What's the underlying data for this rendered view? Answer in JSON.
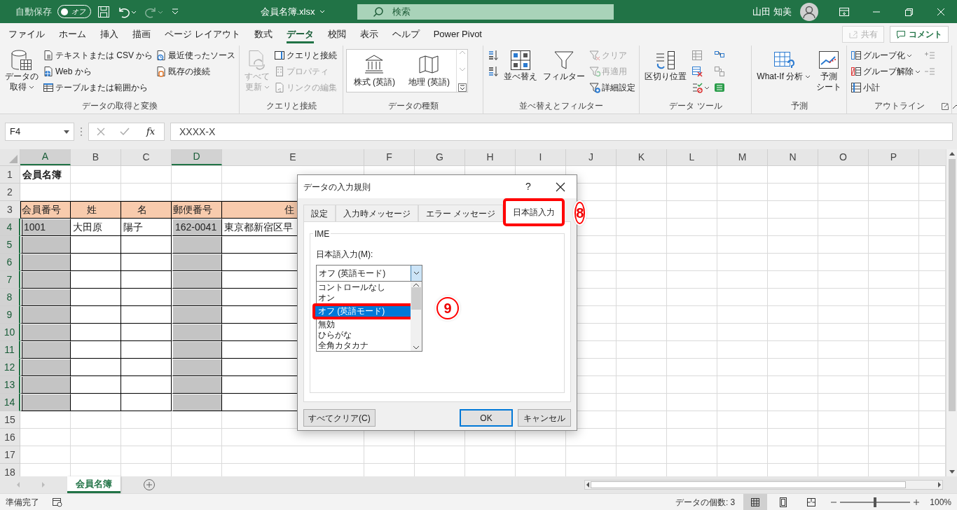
{
  "title_bar": {
    "autosave_label": "自動保存",
    "autosave_on": false,
    "autosave_state": "オフ",
    "quick_access": [
      {
        "kind": "save",
        "disabled": false
      },
      {
        "kind": "undo",
        "disabled": false
      },
      {
        "kind": "redo",
        "disabled": true
      },
      {
        "kind": "customize",
        "disabled": false
      }
    ],
    "filename": "会員名簿.xlsx",
    "search_placeholder": "検索",
    "user_name": "山田 知美"
  },
  "menu_tabs": [
    {
      "label": "ファイル",
      "selected": false
    },
    {
      "label": "ホーム",
      "selected": false
    },
    {
      "label": "挿入",
      "selected": false
    },
    {
      "label": "描画",
      "selected": false
    },
    {
      "label": "ページ レイアウト",
      "selected": false
    },
    {
      "label": "数式",
      "selected": false
    },
    {
      "label": "データ",
      "selected": true
    },
    {
      "label": "校閲",
      "selected": false
    },
    {
      "label": "表示",
      "selected": false
    },
    {
      "label": "ヘルプ",
      "selected": false
    },
    {
      "label": "Power Pivot",
      "selected": false
    }
  ],
  "share_button": {
    "label": "共有",
    "disabled": true
  },
  "comment_button": {
    "label": "コメント"
  },
  "ribbon_groups": [
    {
      "label": "データの取得と変換",
      "launcher": false,
      "items": [
        {
          "kind": "large",
          "label_lines": [
            "データの",
            "取得"
          ],
          "dropdown": true,
          "disabled": false
        },
        {
          "kind": "small",
          "label": "テキストまたは CSV から",
          "disabled": false
        },
        {
          "kind": "small",
          "label": "Web から",
          "disabled": false
        },
        {
          "kind": "small",
          "label": "テーブルまたは範囲から",
          "disabled": false
        },
        {
          "kind": "small",
          "label": "最近使ったソース",
          "disabled": false
        },
        {
          "kind": "small",
          "label": "既存の接続",
          "disabled": false
        }
      ]
    },
    {
      "label": "クエリと接続",
      "launcher": false,
      "items": [
        {
          "kind": "large",
          "label_lines": [
            "すべて",
            "更新"
          ],
          "dropdown": true,
          "disabled": true
        },
        {
          "kind": "small",
          "label": "クエリと接続",
          "disabled": false
        },
        {
          "kind": "small",
          "label": "プロパティ",
          "disabled": true
        },
        {
          "kind": "small",
          "label": "リンクの編集",
          "disabled": true
        }
      ]
    },
    {
      "label": "データの種類",
      "launcher": false,
      "items": [
        {
          "kind": "gallery",
          "options": [
            "株式 (英語)",
            "地理 (英語)"
          ]
        }
      ]
    },
    {
      "label": "並べ替えとフィルター",
      "launcher": false,
      "items": [
        {
          "kind": "icon",
          "disabled": false
        },
        {
          "kind": "icon",
          "disabled": false
        },
        {
          "kind": "large",
          "label_lines": [
            "並べ替え"
          ],
          "disabled": false
        },
        {
          "kind": "large",
          "label_lines": [
            "フィルター"
          ],
          "disabled": false
        },
        {
          "kind": "small",
          "label": "クリア",
          "disabled": true
        },
        {
          "kind": "small",
          "label": "再適用",
          "disabled": true
        },
        {
          "kind": "small",
          "label": "詳細設定",
          "disabled": false
        }
      ]
    },
    {
      "label": "データ ツール",
      "launcher": false,
      "items": [
        {
          "kind": "large",
          "label_lines": [
            "区切り位置"
          ],
          "disabled": false
        },
        {
          "kind": "icon",
          "disabled": true
        },
        {
          "kind": "icon",
          "disabled": false
        },
        {
          "kind": "icon",
          "disabled": false,
          "dropdown": true
        },
        {
          "kind": "icon",
          "disabled": false
        },
        {
          "kind": "icon",
          "disabled": true
        },
        {
          "kind": "icon",
          "disabled": false
        }
      ]
    },
    {
      "label": "予測",
      "launcher": false,
      "items": [
        {
          "kind": "large",
          "label_lines": [
            "What-If 分析"
          ],
          "dropdown": true,
          "disabled": false
        },
        {
          "kind": "large",
          "label_lines": [
            "予測",
            "シート"
          ],
          "disabled": false
        }
      ]
    },
    {
      "label": "アウトライン",
      "launcher": true,
      "items": [
        {
          "kind": "small",
          "label": "グループ化",
          "dropdown": true,
          "disabled": false
        },
        {
          "kind": "small",
          "label": "グループ解除",
          "dropdown": true,
          "disabled": false
        },
        {
          "kind": "small",
          "label": "小計",
          "disabled": false
        },
        {
          "kind": "icon",
          "disabled": true
        },
        {
          "kind": "icon",
          "disabled": true
        }
      ]
    }
  ],
  "formula_bar": {
    "name_box": "F4",
    "function_label": "fx",
    "formula": "XXXX-X"
  },
  "grid": {
    "columns": [
      {
        "label": "A",
        "selected": true,
        "in_table": true
      },
      {
        "label": "B",
        "selected": false,
        "in_table": true
      },
      {
        "label": "C",
        "selected": false,
        "in_table": true
      },
      {
        "label": "D",
        "selected": true,
        "in_table": true
      },
      {
        "label": "E",
        "selected": false,
        "in_table": true
      },
      {
        "label": "F",
        "selected": false,
        "in_table": false
      },
      {
        "label": "G",
        "selected": false,
        "in_table": false
      },
      {
        "label": "H",
        "selected": false,
        "in_table": false
      },
      {
        "label": "I",
        "selected": false,
        "in_table": false
      },
      {
        "label": "J",
        "selected": false,
        "in_table": false
      },
      {
        "label": "K",
        "selected": false,
        "in_table": false
      },
      {
        "label": "L",
        "selected": false,
        "in_table": false
      },
      {
        "label": "M",
        "selected": false,
        "in_table": false
      },
      {
        "label": "N",
        "selected": false,
        "in_table": false
      },
      {
        "label": "O",
        "selected": false,
        "in_table": false
      },
      {
        "label": "P",
        "selected": false,
        "in_table": false
      }
    ],
    "rows": [
      {
        "label": "1",
        "kind": "title",
        "selected": false,
        "cells": [
          "会員名簿"
        ]
      },
      {
        "label": "2",
        "kind": "blank",
        "selected": false,
        "cells": []
      },
      {
        "label": "3",
        "kind": "header",
        "selected": false,
        "cells": [
          "会員番号",
          "姓",
          "名",
          "郵便番号",
          "住"
        ]
      },
      {
        "label": "4",
        "kind": "record",
        "selected": true,
        "cells": [
          "1001",
          "大田原",
          "陽子",
          "162-0041",
          "東京都新宿区早"
        ]
      },
      {
        "label": "5",
        "kind": "record",
        "selected": true,
        "cells": []
      },
      {
        "label": "6",
        "kind": "record",
        "selected": true,
        "cells": []
      },
      {
        "label": "7",
        "kind": "record",
        "selected": true,
        "cells": []
      },
      {
        "label": "8",
        "kind": "record",
        "selected": true,
        "cells": []
      },
      {
        "label": "9",
        "kind": "record",
        "selected": true,
        "cells": []
      },
      {
        "label": "10",
        "kind": "record",
        "selected": true,
        "cells": []
      },
      {
        "label": "11",
        "kind": "record",
        "selected": true,
        "cells": []
      },
      {
        "label": "12",
        "kind": "record",
        "selected": true,
        "cells": []
      },
      {
        "label": "13",
        "kind": "record",
        "selected": true,
        "cells": []
      },
      {
        "label": "14",
        "kind": "record",
        "selected": true,
        "cells": []
      },
      {
        "label": "15",
        "kind": "blank",
        "selected": false,
        "cells": []
      },
      {
        "label": "16",
        "kind": "blank",
        "selected": false,
        "cells": []
      },
      {
        "label": "17",
        "kind": "blank",
        "selected": false,
        "cells": []
      },
      {
        "label": "18",
        "kind": "blank",
        "selected": false,
        "cells": []
      }
    ]
  },
  "dialog": {
    "title": "データの入力規則",
    "help": "?",
    "tabs": [
      {
        "label": "設定",
        "selected": false
      },
      {
        "label": "入力時メッセージ",
        "selected": false
      },
      {
        "label": "エラー メッセージ",
        "selected": false
      },
      {
        "label": "日本語入力",
        "selected": true,
        "callout": "8"
      }
    ],
    "group_label": "IME",
    "field_label": "日本語入力(M):",
    "combo": {
      "value": "オフ (英語モード)",
      "expanded": true,
      "options": [
        {
          "label": "コントロールなし",
          "selected": false
        },
        {
          "label": "オン",
          "selected": false
        },
        {
          "label": "オフ (英語モード)",
          "selected": true,
          "callout": "9"
        },
        {
          "label": "無効",
          "selected": false
        },
        {
          "label": "ひらがな",
          "selected": false
        },
        {
          "label": "全角カタカナ",
          "selected": false
        }
      ]
    },
    "buttons": [
      {
        "label": "すべてクリア(C)",
        "default": false
      },
      {
        "label": "OK",
        "default": true
      },
      {
        "label": "キャンセル",
        "default": false
      }
    ]
  },
  "sheet_tabs": [
    {
      "label": "会員名簿",
      "selected": true
    }
  ],
  "status_bar": {
    "status": "準備完了",
    "count": "データの個数: 3",
    "views": [
      {
        "kind": "normal",
        "selected": true
      },
      {
        "kind": "page_layout",
        "selected": false
      },
      {
        "kind": "page_break",
        "selected": false
      }
    ],
    "zoom": {
      "level": 0.5,
      "reading": "100%"
    }
  }
}
